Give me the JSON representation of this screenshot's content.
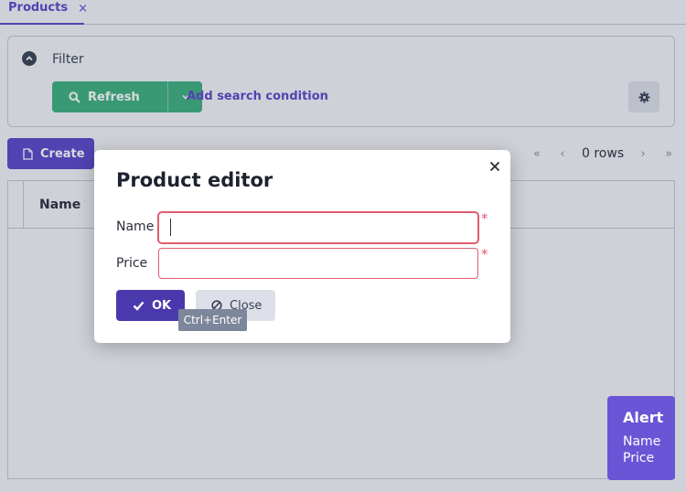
{
  "tab": {
    "label": "Products",
    "close_glyph": "×"
  },
  "filter": {
    "label": "Filter",
    "refresh_label": "Refresh",
    "add_condition_label": "Add search condition"
  },
  "toolbar": {
    "create_label": "Create"
  },
  "pager": {
    "first": "«",
    "prev": "‹",
    "rows_label": "0 rows",
    "next": "›",
    "last": "»"
  },
  "grid": {
    "columns": [
      "Name"
    ]
  },
  "dialog": {
    "title": "Product editor",
    "fields": [
      {
        "label": "Name",
        "value": "",
        "required": "*"
      },
      {
        "label": "Price",
        "value": "",
        "required": "*"
      }
    ],
    "ok_label": "OK",
    "close_label": "Close",
    "ok_shortcut": "Ctrl+Enter"
  },
  "alert": {
    "title": "Alert",
    "items": [
      "Name",
      "Price"
    ]
  },
  "colors": {
    "accent": "#5b47c9",
    "success": "#3fb07f",
    "error": "#e05b6f",
    "alert": "#6a55d6"
  }
}
